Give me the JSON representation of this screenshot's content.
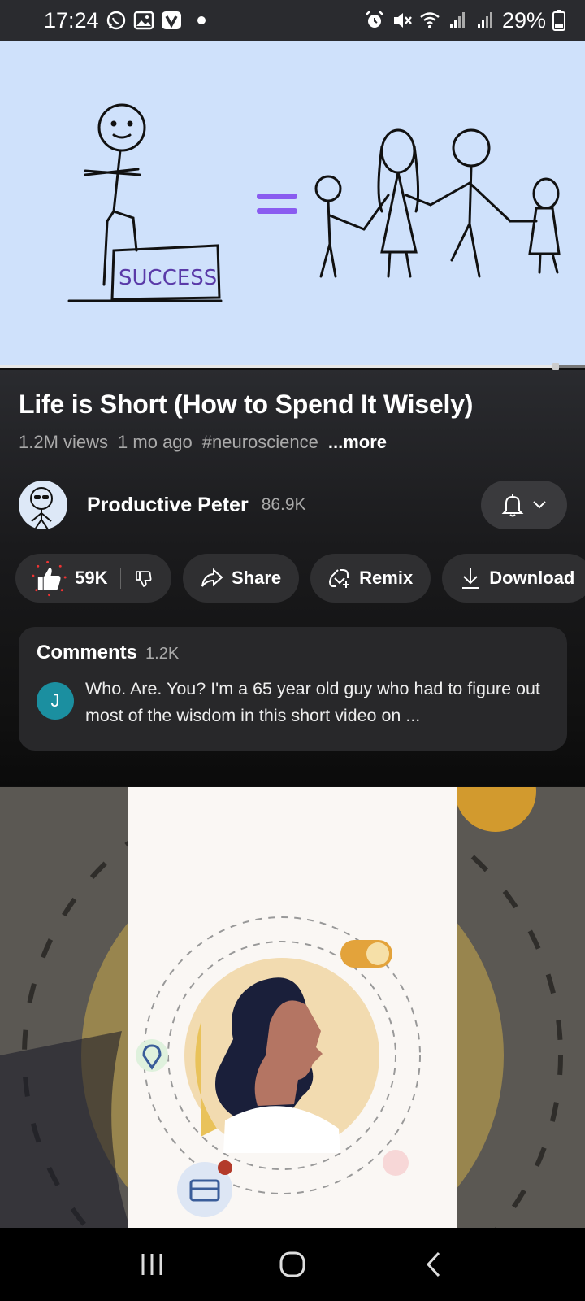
{
  "status_bar": {
    "time": "17:24",
    "battery": "29%",
    "icons": [
      "whatsapp-icon",
      "gallery-icon",
      "v-app-icon",
      "dot-icon",
      "alarm-icon",
      "mute-icon",
      "wifi-icon",
      "signal-icon",
      "signal-icon",
      "battery-icon"
    ]
  },
  "video": {
    "sign_text": "SUCCESS",
    "progress_fraction": 0.95
  },
  "info": {
    "title": "Life is Short (How to Spend It Wisely)",
    "views": "1.2M views",
    "age": "1 mo ago",
    "hashtag": "#neuroscience",
    "more": "...more"
  },
  "channel": {
    "name": "Productive Peter",
    "subscribers": "86.9K"
  },
  "actions": {
    "likes": "59K",
    "share": "Share",
    "remix": "Remix",
    "download": "Download"
  },
  "comments": {
    "title": "Comments",
    "count": "1.2K",
    "avatar_letter": "J",
    "preview": "Who. Are. You? I'm a 65 year old guy who had to figure out most of the wisdom in this short video on ..."
  },
  "colors": {
    "accent_teal": "#1b8fa0",
    "video_bg": "#cfe1fb",
    "equals_purple": "#8a5cf0"
  }
}
